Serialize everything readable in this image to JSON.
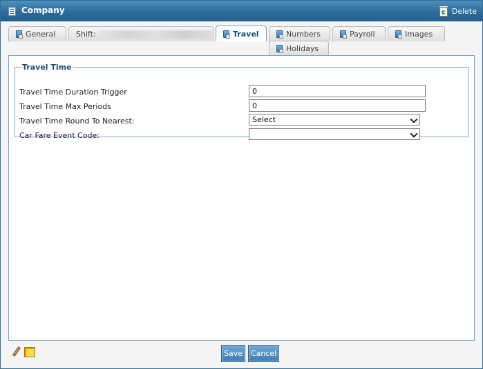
{
  "window": {
    "title": "Company",
    "delete_label": "Delete"
  },
  "tabs": [
    {
      "label": "General",
      "active": false
    },
    {
      "label": "Shift:",
      "active": false
    },
    {
      "label": "Travel",
      "active": true
    },
    {
      "label": "Numbers",
      "active": false
    },
    {
      "label": "Payroll",
      "active": false
    },
    {
      "label": "Images",
      "active": false
    },
    {
      "label": "Holidays",
      "active": false
    }
  ],
  "travel_time": {
    "legend": "Travel Time",
    "duration_trigger": {
      "label": "Travel Time Duration Trigger",
      "value": "0"
    },
    "max_periods": {
      "label": "Travel Time Max Periods",
      "value": "0"
    },
    "round_to_nearest": {
      "label": "Travel Time Round To Nearest:",
      "selected": "Select"
    },
    "car_fare_event_code": {
      "label": "Car Fare Event Code:",
      "selected": ""
    }
  },
  "footer": {
    "save_label": "Save",
    "cancel_label": "Cancel"
  },
  "colors": {
    "titlebar": "#2b6c9c",
    "accent": "#1b4d7a",
    "button": "#4f8dc2"
  }
}
